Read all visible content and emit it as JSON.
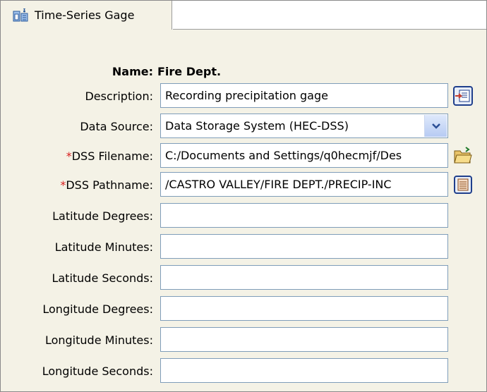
{
  "tab": {
    "label": "Time-Series Gage",
    "icon": "gage-icon"
  },
  "form": {
    "name_label": "Name:",
    "name_value": "Fire Dept.",
    "description_label": "Description:",
    "description_value": "Recording precipitation gage",
    "data_source_label": "Data Source:",
    "data_source_value": "Data Storage System (HEC-DSS)",
    "required_marker": "*",
    "dss_filename_label": "DSS Filename:",
    "dss_filename_value": "C:/Documents and Settings/q0hecmjf/Des",
    "dss_pathname_label": "DSS Pathname:",
    "dss_pathname_value": "/CASTRO VALLEY/FIRE DEPT./PRECIP-INC",
    "lat_deg_label": "Latitude Degrees:",
    "lat_deg_value": "",
    "lat_min_label": "Latitude Minutes:",
    "lat_min_value": "",
    "lat_sec_label": "Latitude Seconds:",
    "lat_sec_value": "",
    "lon_deg_label": "Longitude Degrees:",
    "lon_deg_value": "",
    "lon_min_label": "Longitude Minutes:",
    "lon_min_value": "",
    "lon_sec_label": "Longitude Seconds:",
    "lon_sec_value": ""
  },
  "icons": {
    "description_button": "edit-description-icon",
    "data_source_arrow": "chevron-down-icon",
    "filename_button": "open-folder-icon",
    "pathname_button": "select-path-icon"
  },
  "colors": {
    "required": "#d81e1e",
    "field_border": "#7f9db9",
    "panel_bg": "#f4f2e6"
  }
}
